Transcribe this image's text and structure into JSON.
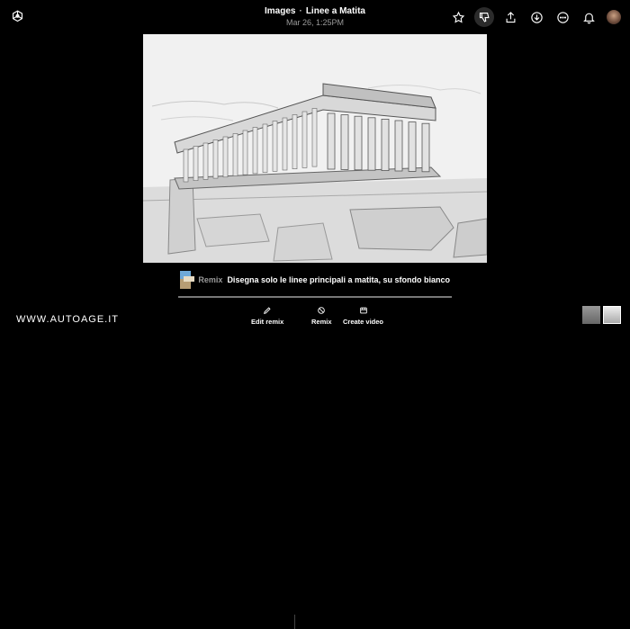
{
  "header": {
    "app": "Images",
    "separator": "·",
    "title": "Linee a Matita",
    "date": "Mar 26, 1:25PM",
    "icons": [
      "star-icon",
      "thumbs-down-icon",
      "share-icon",
      "download-icon",
      "more-icon",
      "bell-icon",
      "avatar"
    ]
  },
  "remix": {
    "label": "Remix",
    "prompt": "Disegna solo le linee principali a matita, su sfondo bianco",
    "progress": 1.0
  },
  "actions": {
    "edit": "Edit remix",
    "remix": "Remix",
    "video": "Create video"
  },
  "watermark": "WWW.AUTOAGE.IT",
  "colors": {
    "background": "#000000",
    "muted": "#9a9a9a",
    "active_button": "#2b2b2b"
  }
}
